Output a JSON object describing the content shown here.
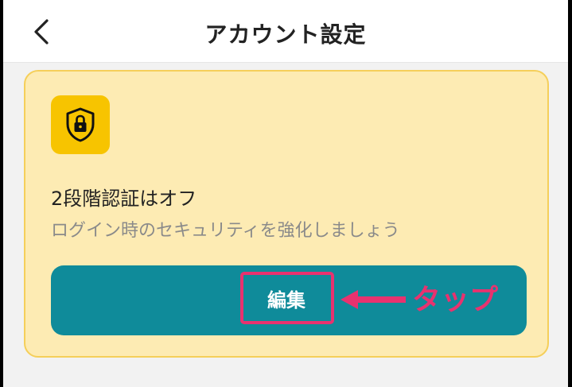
{
  "header": {
    "title": "アカウント設定",
    "back_icon": "chevron-left-icon"
  },
  "card": {
    "icon": "shield-lock-icon",
    "status": "2段階認証はオフ",
    "description": "ログイン時のセキュリティを強化しましょう",
    "button_label": "編集"
  },
  "annotation": {
    "label": "タップ",
    "color": "#e8326f"
  },
  "colors": {
    "card_bg": "#fdebb3",
    "card_border": "#f5cf5a",
    "icon_bg": "#f7c400",
    "button_bg": "#0f8b9a",
    "annotation": "#e8326f"
  }
}
